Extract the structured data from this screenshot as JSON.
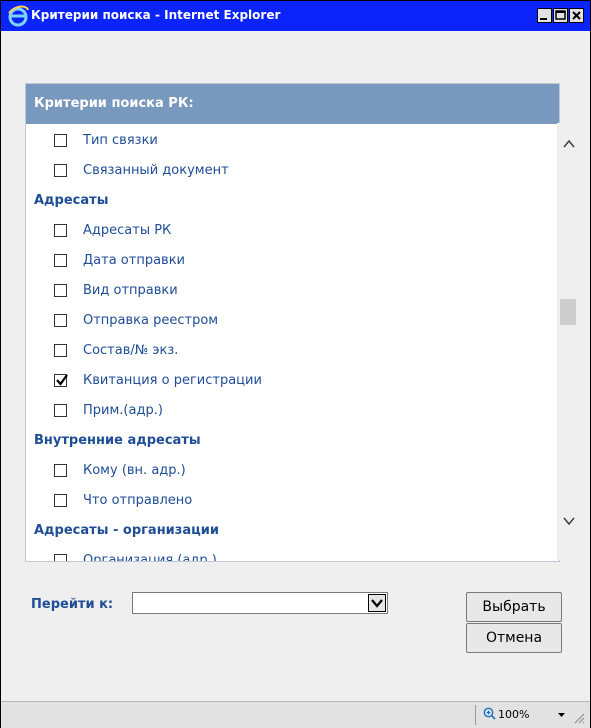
{
  "window": {
    "title": "Критерии поиска - Internet Explorer"
  },
  "panel": {
    "header": "Критерии поиска РК:"
  },
  "list": {
    "rows": [
      {
        "type": "item",
        "label": "Тип связки",
        "checked": false
      },
      {
        "type": "item",
        "label": "Связанный документ",
        "checked": false
      },
      {
        "type": "group",
        "label": "Адресаты"
      },
      {
        "type": "item",
        "label": "Адресаты РК",
        "checked": false
      },
      {
        "type": "item",
        "label": "Дата отправки",
        "checked": false
      },
      {
        "type": "item",
        "label": "Вид отправки",
        "checked": false
      },
      {
        "type": "item",
        "label": "Отправка реестром",
        "checked": false
      },
      {
        "type": "item",
        "label": "Состав/№ экз.",
        "checked": false
      },
      {
        "type": "item",
        "label": "Квитанция о регистрации",
        "checked": true
      },
      {
        "type": "item",
        "label": "Прим.(адр.)",
        "checked": false
      },
      {
        "type": "group",
        "label": "Внутренние адресаты"
      },
      {
        "type": "item",
        "label": "Кому (вн. адр.)",
        "checked": false
      },
      {
        "type": "item",
        "label": "Что отправлено",
        "checked": false
      },
      {
        "type": "group",
        "label": "Адресаты - организации"
      },
      {
        "type": "item",
        "label": "Организация (адр.)",
        "checked": false
      }
    ]
  },
  "goto": {
    "label": "Перейти к:",
    "value": ""
  },
  "buttons": {
    "select": "Выбрать",
    "cancel": "Отмена"
  },
  "statusbar": {
    "zoom": "100%"
  },
  "colors": {
    "titlebar": "#0b24fb",
    "panel_header": "#7898be",
    "link_text": "#1f4d96"
  }
}
